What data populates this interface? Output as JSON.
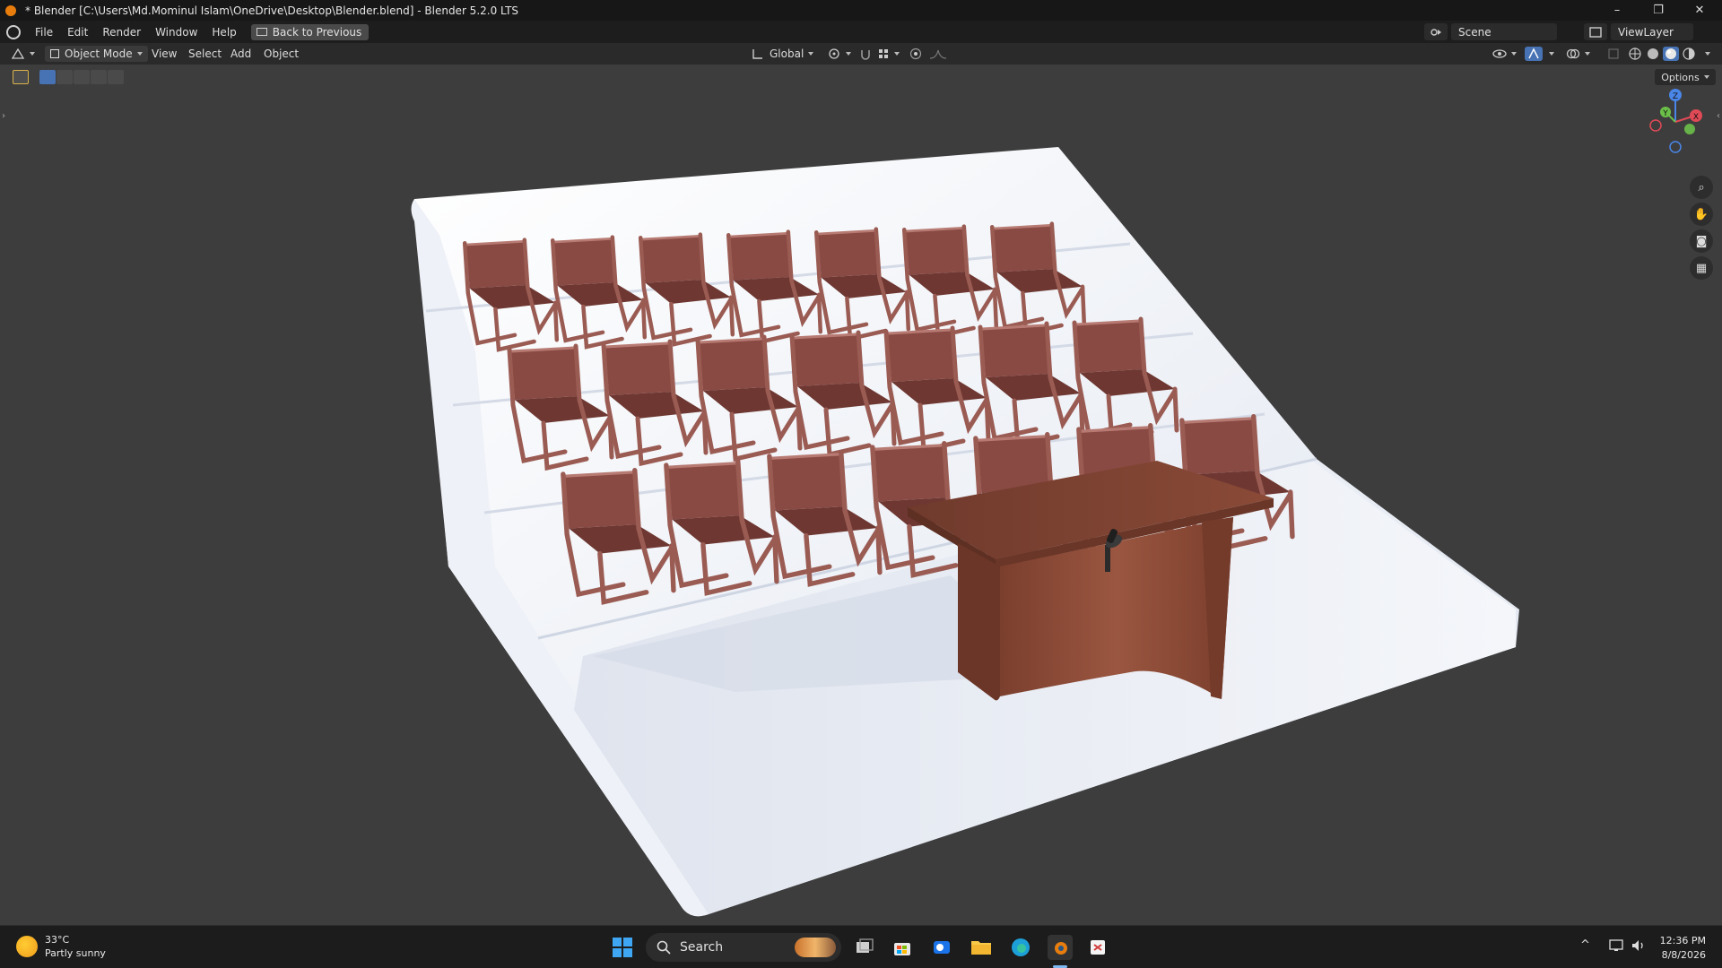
{
  "window": {
    "title": "* Blender [C:\\Users\\Md.Mominul Islam\\OneDrive\\Desktop\\Blender.blend] - Blender 5.2.0 LTS",
    "minimize": "–",
    "maximize": "❐",
    "close": "✕"
  },
  "menu": {
    "items": [
      "File",
      "Edit",
      "Render",
      "Window",
      "Help"
    ],
    "back_button": "Back to Previous",
    "scene": "Scene",
    "view_layer": "ViewLayer"
  },
  "viewport_header": {
    "mode": "Object Mode",
    "menus": [
      "View",
      "Select",
      "Add",
      "Object"
    ],
    "transform_orientation": "Global",
    "options": "Options"
  },
  "gizmo": {
    "z": "Z",
    "y": "Y",
    "x": "X"
  },
  "taskbar": {
    "temperature": "33°C",
    "weather": "Partly sunny",
    "search_placeholder": "Search",
    "time": "12:36 PM",
    "date": "8/8/2026"
  },
  "colors": {
    "chair": "#8a4a44",
    "desk": "#7a3e2e",
    "stage": "#f2f4f8",
    "viewport_bg": "#3d3d3d",
    "accent": "#4772b3"
  }
}
